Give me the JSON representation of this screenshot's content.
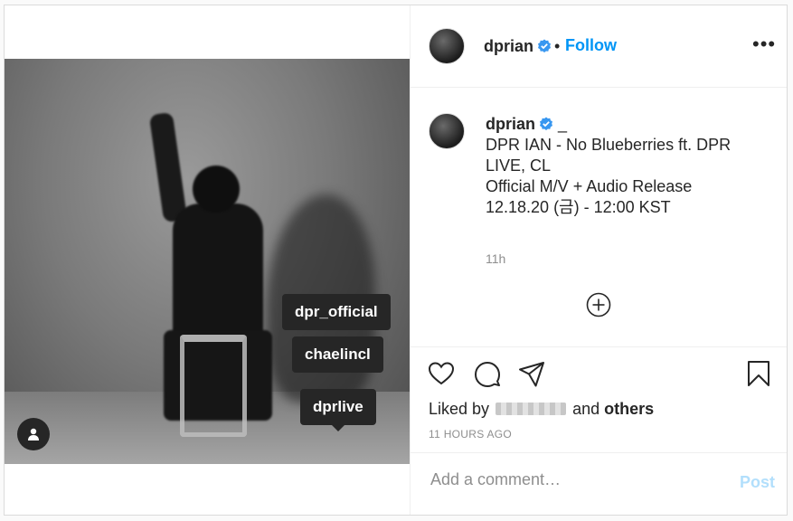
{
  "post": {
    "author": "dprian",
    "verified": true,
    "follow_label": "Follow",
    "separator": "•",
    "more_label": "•••",
    "caption": {
      "author": "dprian",
      "suffix": "_",
      "lines": [
        "DPR IAN - No Blueberries ft. DPR LIVE, CL",
        "Official M/V + Audio Release",
        "12.18.20 (금) - 12:00 KST"
      ],
      "time": "11h"
    },
    "tags": [
      "dpr_official",
      "chaelincl",
      "dprlive"
    ],
    "likes": {
      "prefix": "Liked by",
      "and": "and",
      "others": "others"
    },
    "timestamp": "11 HOURS AGO",
    "comment": {
      "placeholder": "Add a comment…",
      "post_label": "Post"
    }
  },
  "icons": [
    "verified-badge-icon",
    "more-options-icon",
    "add-circle-icon",
    "heart-icon",
    "comment-icon",
    "share-icon",
    "bookmark-icon",
    "user-tags-icon"
  ],
  "colors": {
    "link": "#0095f6",
    "post_disabled": "#b2dffc",
    "text": "#262626",
    "muted": "#8e8e8e",
    "tag_bg": "#262626"
  }
}
